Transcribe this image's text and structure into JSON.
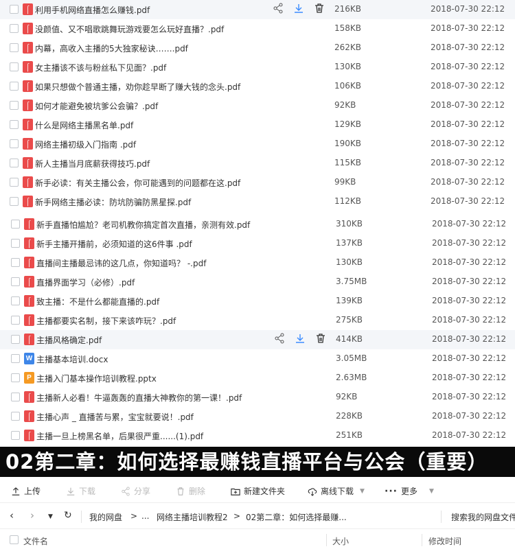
{
  "files_group1": [
    {
      "name": "利用手机网络直播怎么赚钱.pdf",
      "type": "pdf",
      "size": "216KB",
      "date": "2018-07-30 22:12",
      "hover": true
    },
    {
      "name": "没颜值、又不唱歌跳舞玩游戏要怎么玩好直播？.pdf",
      "type": "pdf",
      "size": "158KB",
      "date": "2018-07-30 22:12"
    },
    {
      "name": "内幕，高收入主播的5大独家秘诀…….pdf",
      "type": "pdf",
      "size": "262KB",
      "date": "2018-07-30 22:12"
    },
    {
      "name": "女主播该不该与粉丝私下见面？.pdf",
      "type": "pdf",
      "size": "130KB",
      "date": "2018-07-30 22:12"
    },
    {
      "name": "如果只想做个普通主播，劝你趁早断了赚大钱的念头.pdf",
      "type": "pdf",
      "size": "106KB",
      "date": "2018-07-30 22:12"
    },
    {
      "name": "如何才能避免被坑爹公会骗？.pdf",
      "type": "pdf",
      "size": "92KB",
      "date": "2018-07-30 22:12"
    },
    {
      "name": "什么是网络主播黑名单.pdf",
      "type": "pdf",
      "size": "129KB",
      "date": "2018-07-30 22:12"
    },
    {
      "name": "网络主播初级入门指南 .pdf",
      "type": "pdf",
      "size": "190KB",
      "date": "2018-07-30 22:12"
    },
    {
      "name": "新人主播当月底薪获得技巧.pdf",
      "type": "pdf",
      "size": "115KB",
      "date": "2018-07-30 22:12"
    },
    {
      "name": "新手必读：有关主播公会，你可能遇到的问题都在这.pdf",
      "type": "pdf",
      "size": "99KB",
      "date": "2018-07-30 22:12"
    },
    {
      "name": "新手网络主播必读：防坑防骗防黑星探.pdf",
      "type": "pdf",
      "size": "112KB",
      "date": "2018-07-30 22:12"
    }
  ],
  "files_group2": [
    {
      "name": "新手直播怕尴尬？老司机教你搞定首次直播，亲测有效.pdf",
      "type": "pdf",
      "size": "310KB",
      "date": "2018-07-30 22:12"
    },
    {
      "name": "新手主播开播前，必须知道的这6件事 .pdf",
      "type": "pdf",
      "size": "137KB",
      "date": "2018-07-30 22:12"
    },
    {
      "name": "直播间主播最忌讳的这几点，你知道吗？ -.pdf",
      "type": "pdf",
      "size": "130KB",
      "date": "2018-07-30 22:12"
    },
    {
      "name": "直播界面学习（必修）.pdf",
      "type": "pdf",
      "size": "3.75MB",
      "date": "2018-07-30 22:12"
    },
    {
      "name": "致主播：不是什么都能直播的.pdf",
      "type": "pdf",
      "size": "139KB",
      "date": "2018-07-30 22:12"
    },
    {
      "name": "主播都要实名制，接下来该咋玩？.pdf",
      "type": "pdf",
      "size": "275KB",
      "date": "2018-07-30 22:12"
    },
    {
      "name": "主播风格确定.pdf",
      "type": "pdf",
      "size": "414KB",
      "date": "2018-07-30 22:12",
      "hover": true
    },
    {
      "name": "主播基本培训.docx",
      "type": "docx",
      "size": "3.05MB",
      "date": "2018-07-30 22:12"
    },
    {
      "name": "主播入门基本操作培训教程.pptx",
      "type": "pptx",
      "size": "2.63MB",
      "date": "2018-07-30 22:12"
    },
    {
      "name": "主播新人必看！牛逼轰轰的直播大神教你的第一课！.pdf",
      "type": "pdf",
      "size": "92KB",
      "date": "2018-07-30 22:12"
    },
    {
      "name": "主播心声 _ 直播苦与累，宝宝就要说！.pdf",
      "type": "pdf",
      "size": "228KB",
      "date": "2018-07-30 22:12"
    },
    {
      "name": "主播一旦上榜黑名单，后果很严重......(1).pdf",
      "type": "pdf",
      "size": "251KB",
      "date": "2018-07-30 22:12"
    }
  ],
  "type_glyphs": {
    "docx": "W",
    "pptx": "P"
  },
  "banner": {
    "text": "02第二章：如何选择最赚钱直播平台与公会（重要）"
  },
  "toolbar": {
    "upload": "上传",
    "download": "下载",
    "share": "分享",
    "delete": "删除",
    "new_folder": "新建文件夹",
    "offline_download": "离线下载",
    "more": "更多"
  },
  "nav": {
    "crumb_root": "我的网盘",
    "crumb_sep": ">",
    "crumb_ellipsis": "...",
    "crumb_parent": "网络主播培训教程2",
    "crumb_current": "02第二章：如何选择最赚...",
    "search_placeholder": "搜索我的网盘文件"
  },
  "header": {
    "name": "文件名",
    "size": "大小",
    "modified": "修改时间"
  },
  "colors": {
    "pdf": "#ea4b4b",
    "docx": "#3e86e8",
    "pptx": "#f59a23",
    "accent": "#3b8cff"
  }
}
